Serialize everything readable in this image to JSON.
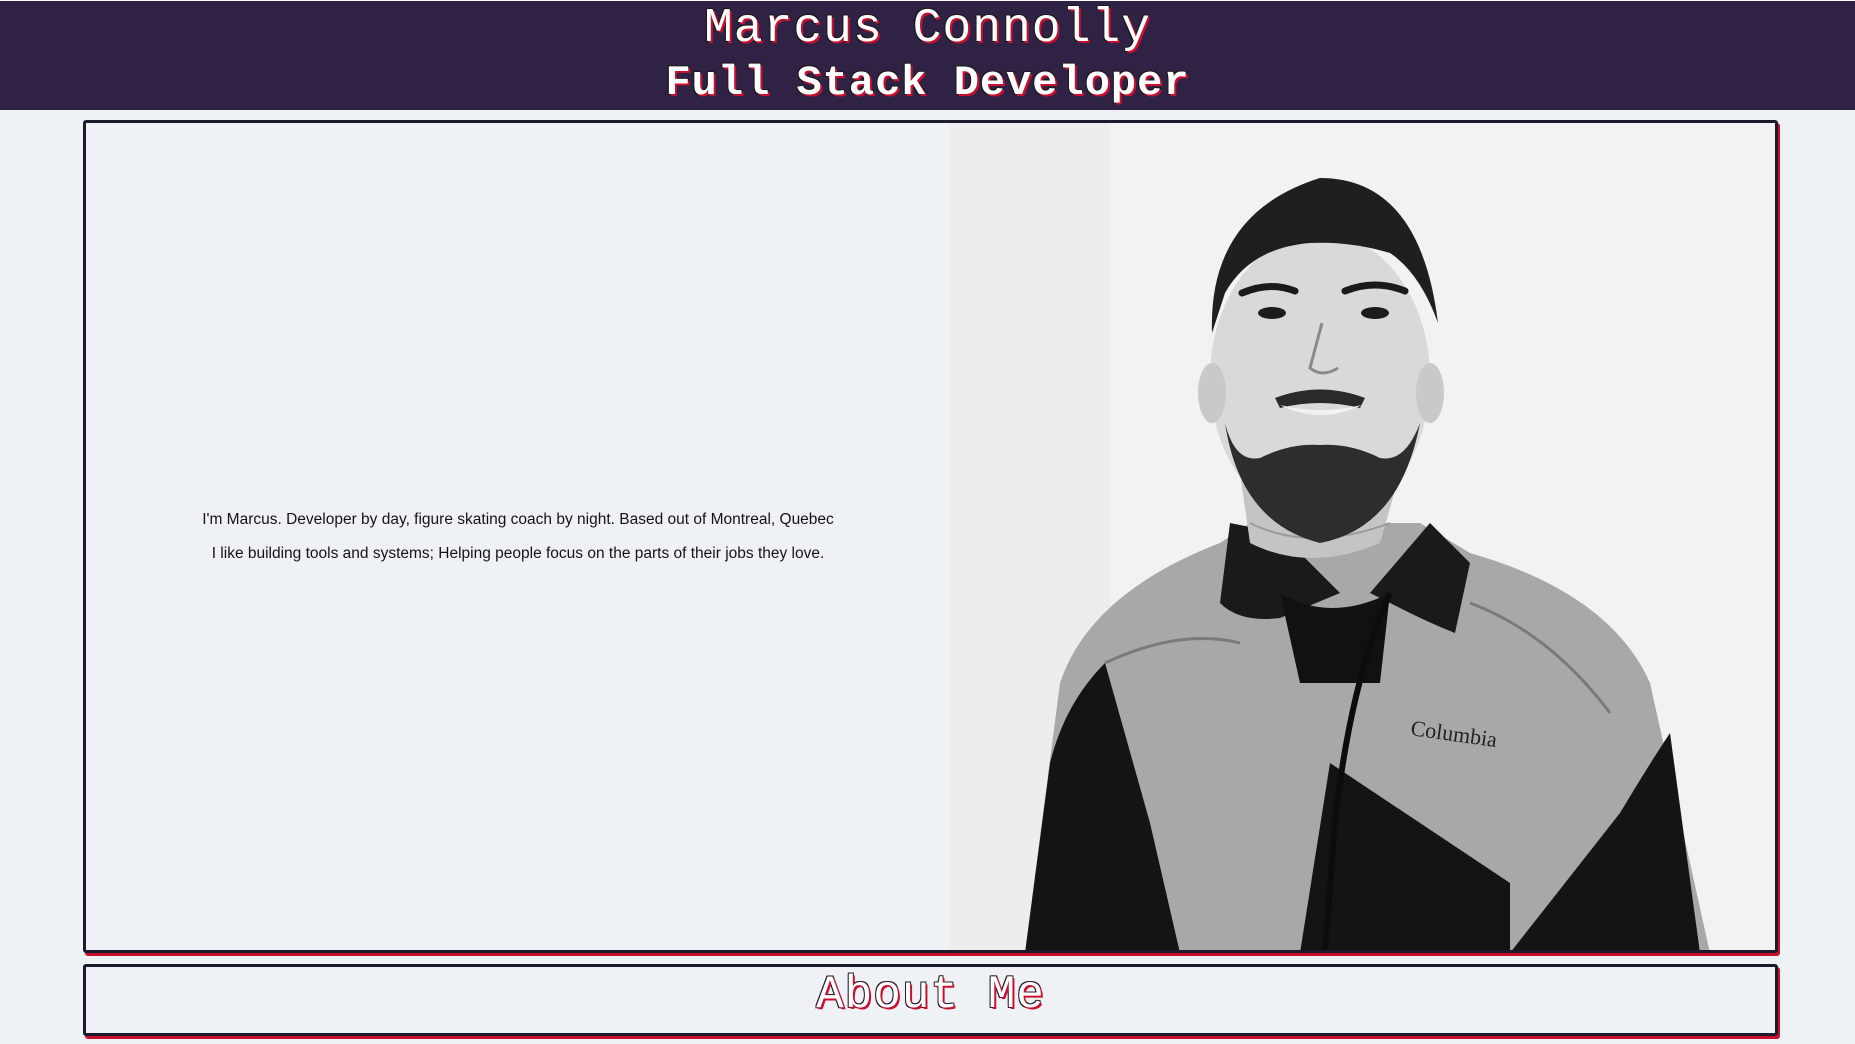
{
  "header": {
    "name": "Marcus Connolly",
    "role": "Full Stack Developer"
  },
  "hero": {
    "intro_line_1": "I'm Marcus. Developer by day, figure skating coach by night. Based out of Montreal, Quebec",
    "intro_line_2": "I like building tools and systems; Helping people focus on the parts of their jobs they love.",
    "portrait_logo_text": "Columbia"
  },
  "about": {
    "heading": "About Me"
  },
  "colors": {
    "header_bg": "#302244",
    "page_bg": "#eef2f5",
    "accent": "#c8102e",
    "border": "#1e1a2e"
  }
}
